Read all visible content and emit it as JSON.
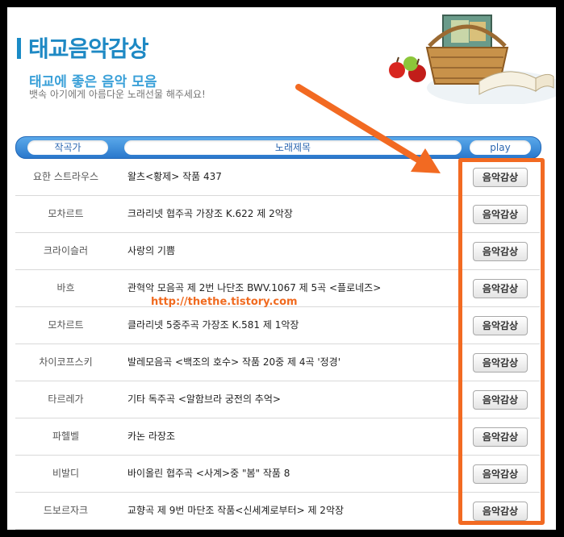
{
  "page": {
    "title": "태교음악감상",
    "subtitle": "태교에 좋은 음악 모음",
    "description": "뱃속 아기에게 아름다운 노래선물 해주세요!"
  },
  "table_header": {
    "composer": "작곡가",
    "song": "노래제목",
    "play": "play"
  },
  "rows": [
    {
      "composer": "요한 스트라우스",
      "song": "왈츠<황제> 작품 437",
      "button": "음악감상"
    },
    {
      "composer": "모차르트",
      "song": "크라리넷 협주곡 가장조 K.622 제 2악장",
      "button": "음악감상"
    },
    {
      "composer": "크라이슬러",
      "song": "사랑의 기쁨",
      "button": "음악감상"
    },
    {
      "composer": "바흐",
      "song": "관혁악 모음곡 제 2번 나단조 BWV.1067 제 5곡 <플로네즈>",
      "button": "음악감상"
    },
    {
      "composer": "모차르트",
      "song": "클라리넷 5중주곡 가장조 K.581 제 1악장",
      "button": "음악감상"
    },
    {
      "composer": "차이코프스키",
      "song": "발레모음곡 <백조의 호수> 작품 20중 제 4곡 '정경'",
      "button": "음악감상"
    },
    {
      "composer": "타르레가",
      "song": "기타 독주곡 <알함브라 궁전의 추억>",
      "button": "음악감상"
    },
    {
      "composer": "파헬벨",
      "song": "카논 라장조",
      "button": "음악감상"
    },
    {
      "composer": "비발디",
      "song": "바이올린 협주곡 <사계>중 \"봄\" 작품 8",
      "button": "음악감상"
    },
    {
      "composer": "드보르자크",
      "song": "교향곡 제 9번 마단조 작품<신세계로부터> 제 2악장",
      "button": "음악감상"
    }
  ],
  "watermark": "http://thethe.tistory.com",
  "colors": {
    "accent": "#1e89c4",
    "annotation": "#f26a22",
    "header_blue": "#2a78cc"
  }
}
